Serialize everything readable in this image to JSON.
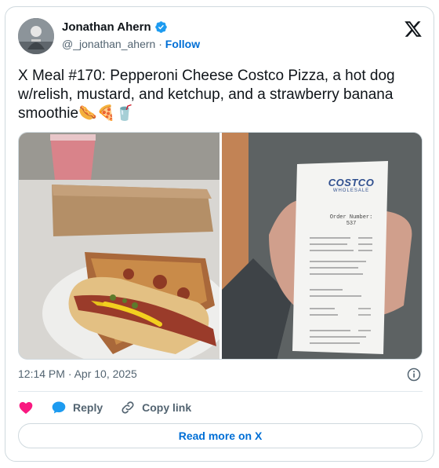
{
  "author": {
    "name": "Jonathan Ahern",
    "handle": "@_jonathan_ahern",
    "separator": "·",
    "follow_label": "Follow"
  },
  "tweet": {
    "text": "X Meal #170: Pepperoni Cheese Costco Pizza, a hot dog w/relish, mustard, and ketchup, and a strawberry banana smoothie🌭🍕🥤"
  },
  "media": {
    "receipt": {
      "brand": "COSTCO",
      "sub_brand": "WHOLESALE",
      "order_label": "Order Number:",
      "order_number": "537"
    }
  },
  "meta": {
    "timestamp": "12:14 PM · Apr 10, 2025"
  },
  "actions": {
    "reply_label": "Reply",
    "copy_link_label": "Copy link"
  },
  "footer": {
    "read_more_label": "Read more on X"
  },
  "colors": {
    "link": "#006fd6",
    "verified": "#1d9bf0",
    "like": "#f91880",
    "text": "#0f1419",
    "muted": "#536471"
  }
}
